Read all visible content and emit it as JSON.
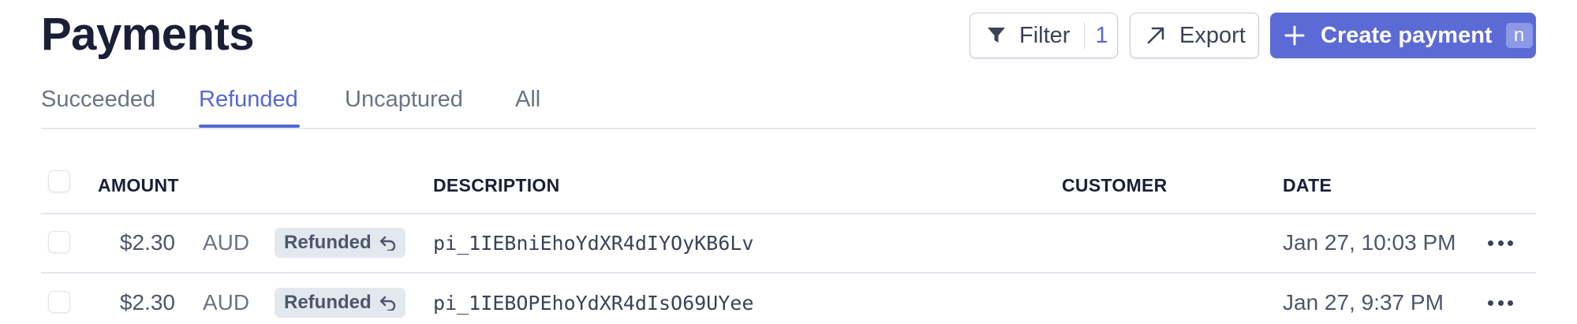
{
  "page": {
    "title": "Payments"
  },
  "toolbar": {
    "filter_label": "Filter",
    "filter_count": "1",
    "export_label": "Export",
    "create_label": "Create payment",
    "create_shortcut": "n",
    "icons": {
      "filter": "filter-funnel-icon",
      "export": "arrow-up-right-icon",
      "create": "plus-icon"
    }
  },
  "tabs": [
    {
      "label": "Succeeded",
      "active": false
    },
    {
      "label": "Refunded",
      "active": true
    },
    {
      "label": "Uncaptured",
      "active": false
    },
    {
      "label": "All",
      "active": false
    }
  ],
  "table": {
    "columns": {
      "amount": "AMOUNT",
      "description": "DESCRIPTION",
      "customer": "CUSTOMER",
      "date": "DATE"
    },
    "rows": [
      {
        "amount": "$2.30",
        "currency": "AUD",
        "status": "Refunded",
        "description": "pi_1IEBniEhoYdXR4dIYOyKB6Lv",
        "customer": "",
        "date": "Jan 27, 10:03 PM"
      },
      {
        "amount": "$2.30",
        "currency": "AUD",
        "status": "Refunded",
        "description": "pi_1IEBOPEhoYdXR4dIsO69UYee",
        "customer": "",
        "date": "Jan 27, 9:37 PM"
      }
    ]
  },
  "colors": {
    "accent": "#5469d4",
    "primary_button": "#5c6ad6",
    "badge_bg": "#e3e8ee"
  }
}
